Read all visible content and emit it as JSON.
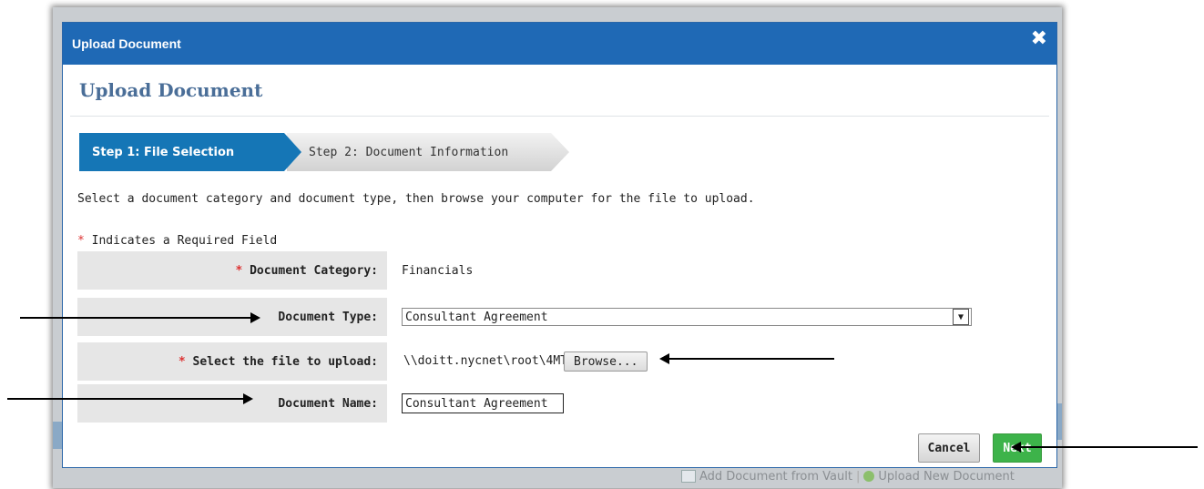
{
  "dialog": {
    "title": "Upload Document",
    "heading": "Upload Document",
    "close_glyph": "✖"
  },
  "steps": [
    {
      "label": "Step 1: File Selection",
      "active": true
    },
    {
      "label": "Step 2: Document Information",
      "active": false
    }
  ],
  "instructions": "Select a document category and document type, then browse your computer for the file to upload.",
  "required_note": {
    "star": "*",
    "text": " Indicates a Required Field"
  },
  "form": {
    "category": {
      "star": "*",
      "label": "Document Category:",
      "value": "Financials"
    },
    "type": {
      "label": "Document Type:",
      "value": "Consultant Agreement",
      "dropdown_icon": "chevron-down-icon"
    },
    "file": {
      "star": "*",
      "label": "Select the file to upload:",
      "value": "\\\\doitt.nycnet\\root\\4MT",
      "browse_label": "Browse..."
    },
    "name": {
      "label": "Document Name:",
      "value": "Consultant Agreement"
    }
  },
  "buttons": {
    "cancel": "Cancel",
    "next": "Next"
  },
  "background": {
    "add_from_vault": "Add Document from Vault",
    "separator": "|",
    "upload_new": "Upload New Document"
  },
  "colors": {
    "title_bar": "#1f69b5",
    "active_step": "#1576b6",
    "next_button": "#3db34a",
    "heading_text": "#4a6e98",
    "required_star": "#dd3333"
  }
}
